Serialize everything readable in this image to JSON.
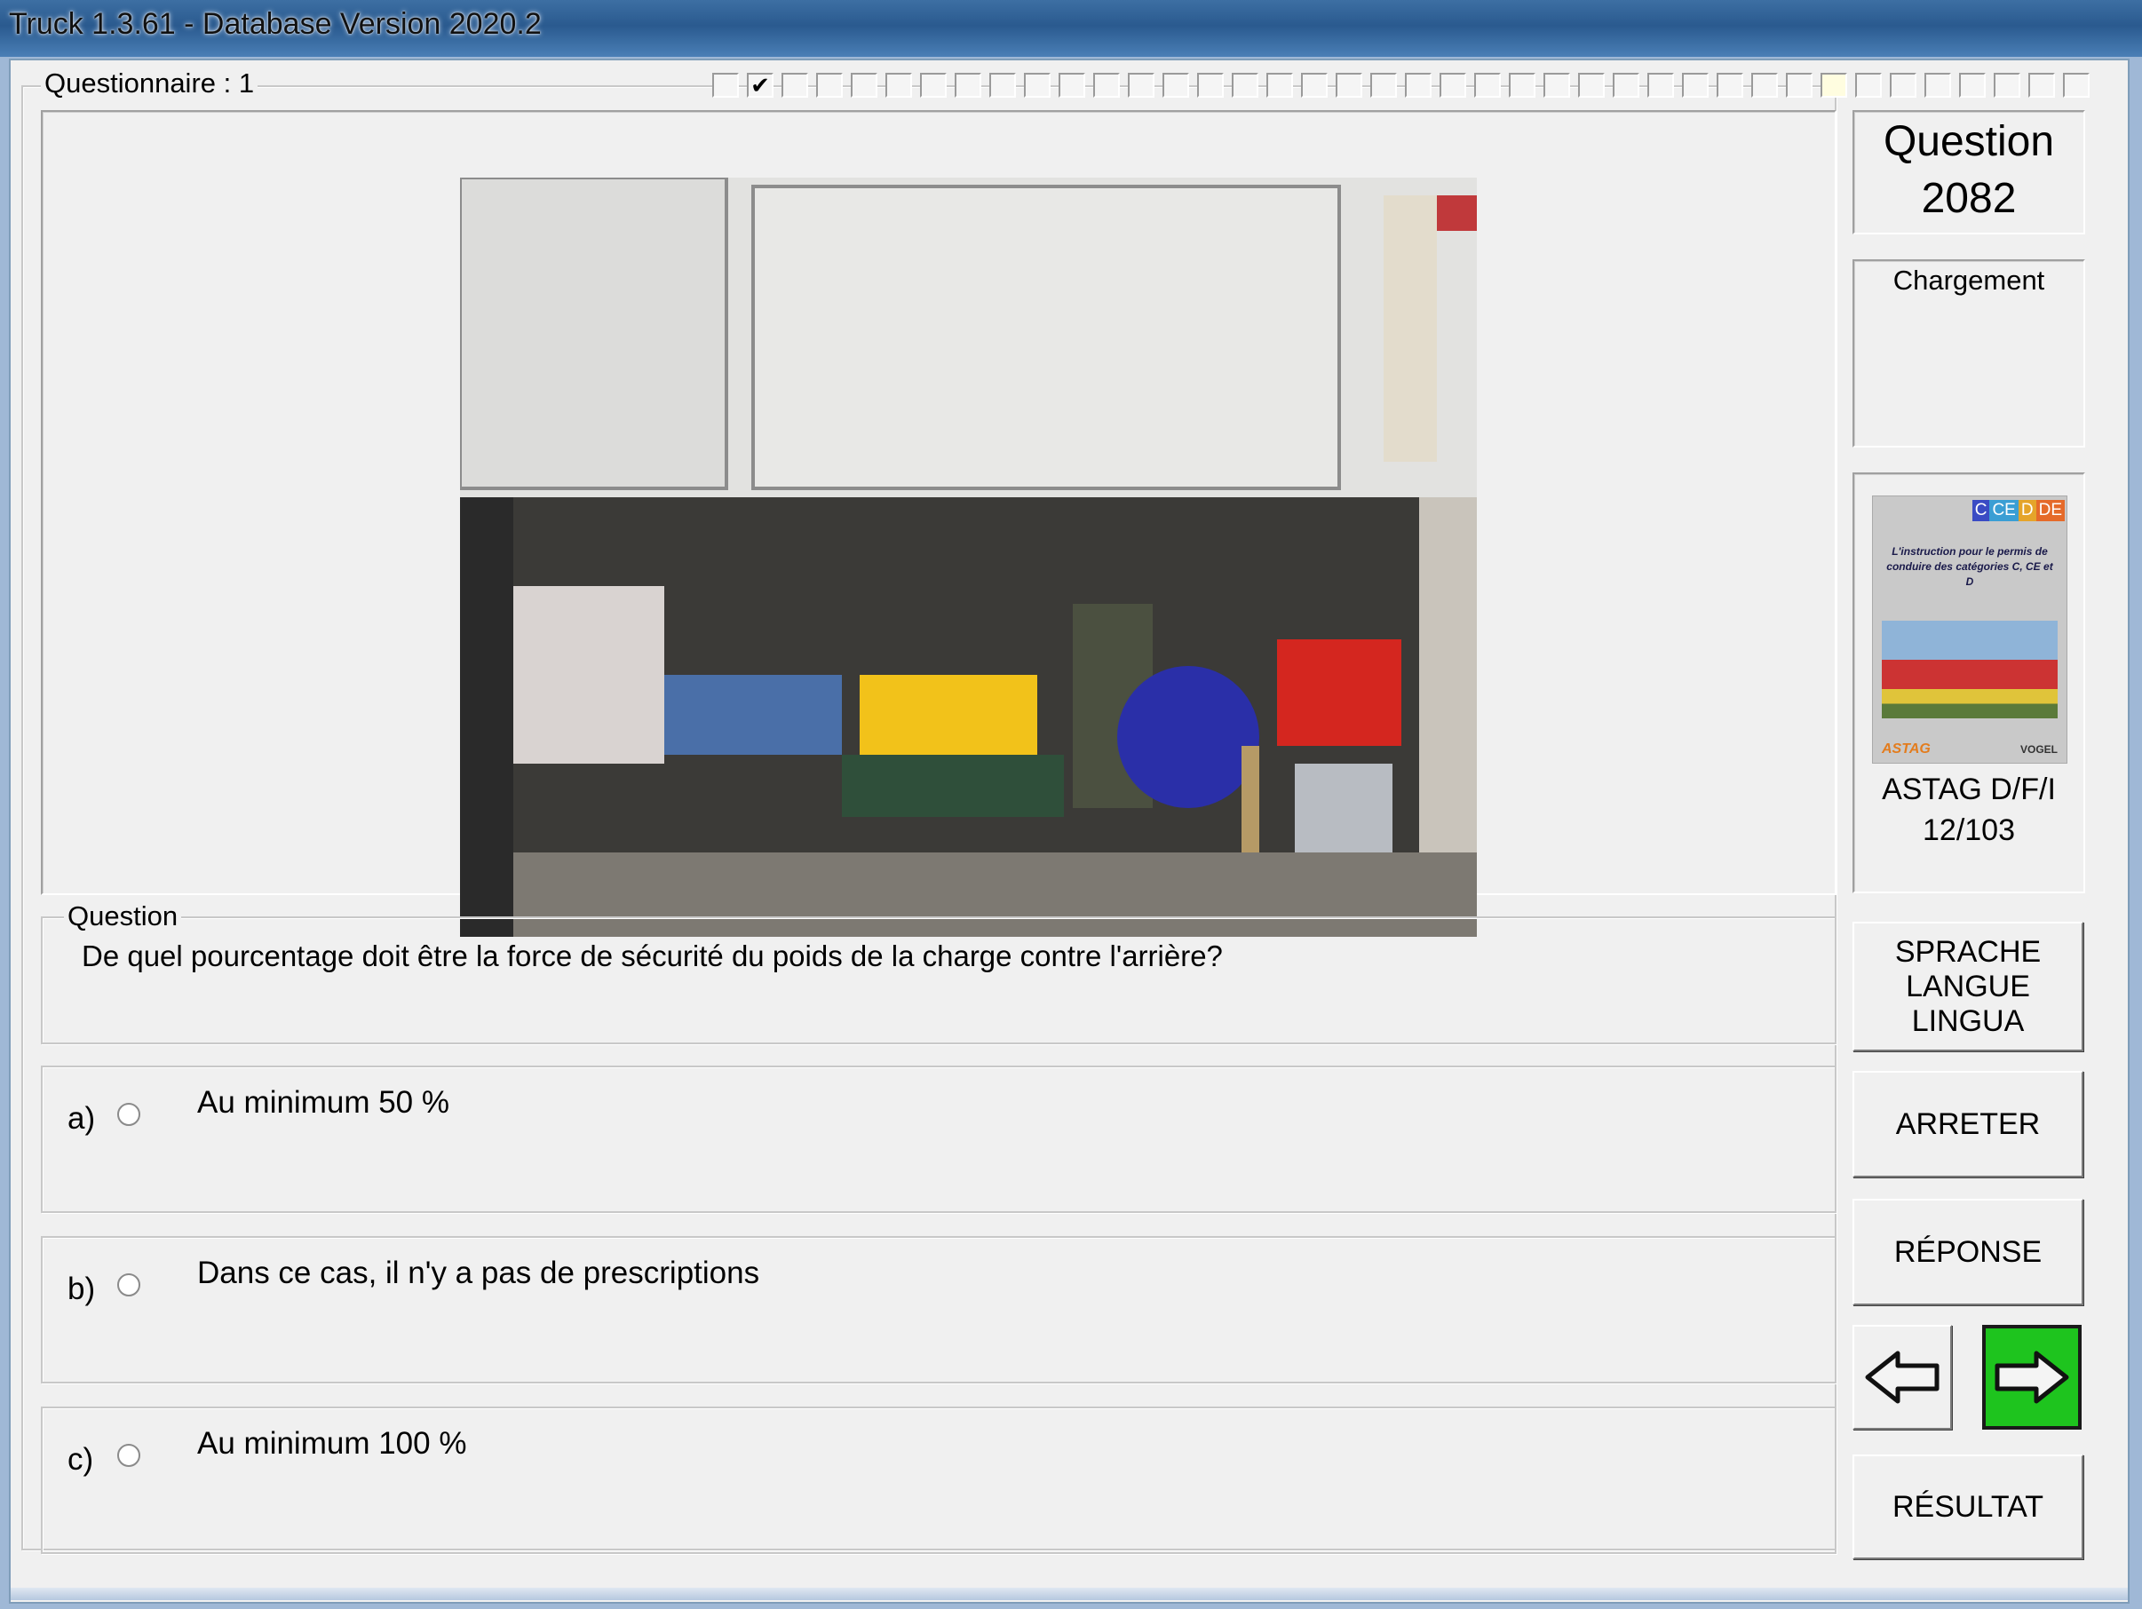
{
  "window": {
    "title": "Truck 1.3.61 - Database Version 2020.2"
  },
  "questionnaire": {
    "label": "Questionnaire : 1",
    "progress_total": 40,
    "progress_checked_index": 1,
    "progress_current_index": 32
  },
  "question": {
    "frame_label": "Question",
    "text": "De quel pourcentage doit être la force de sécurité du poids de la charge contre l'arrière?",
    "number_label": "Question",
    "number": "2082",
    "category": "Chargement"
  },
  "answers": [
    {
      "letter": "a)",
      "text": "Au minimum 50 %"
    },
    {
      "letter": "b)",
      "text": "Dans ce cas, il n'y a pas de prescriptions"
    },
    {
      "letter": "c)",
      "text": "Au minimum 100 %"
    }
  ],
  "book": {
    "cover_categories": [
      "C",
      "CE",
      "D",
      "DE"
    ],
    "cover_title": "L'instruction pour le permis de conduire des catégories C, CE et D",
    "cover_logo_left": "ASTAG",
    "cover_logo_right": "VOGEL",
    "publisher": "ASTAG D/F/I",
    "reference": "12/103"
  },
  "buttons": {
    "language": [
      "SPRACHE",
      "LANGUE",
      "LINGUA"
    ],
    "stop": "ARRETER",
    "answer": "RÉPONSE",
    "result": "RÉSULTAT"
  },
  "icons": {
    "prev": "arrow-left-icon",
    "next": "arrow-right-icon"
  },
  "colors": {
    "next_button": "#1ec41e",
    "titlebar": "#2a5a8f"
  }
}
